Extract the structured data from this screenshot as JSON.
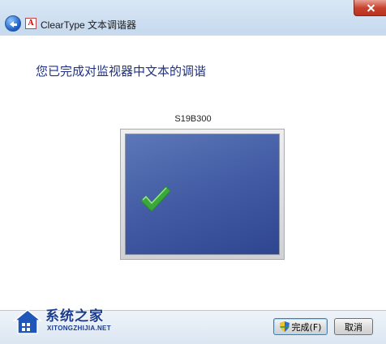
{
  "window": {
    "title": "ClearType 文本调谐器",
    "app_icon_glyph": "A"
  },
  "content": {
    "heading": "您已完成对监视器中文本的调谐",
    "monitor_name": "S19B300",
    "check_color": "#3aa83a",
    "screen_color": "#425ba4"
  },
  "footer": {
    "finish_label": "完成(F)",
    "cancel_label": "取消"
  },
  "watermark": {
    "brand": "系统之家",
    "url": "XITONGZHIJIA.NET"
  }
}
